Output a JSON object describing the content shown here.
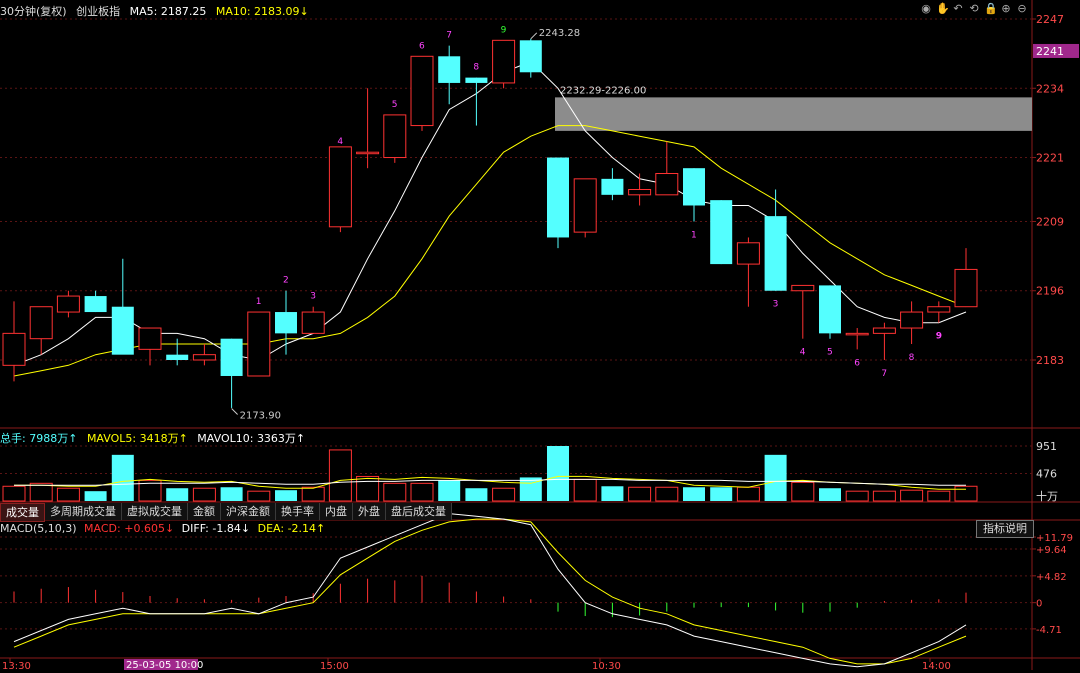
{
  "header": {
    "period": "30分钟(复权)",
    "symbol": "创业板指",
    "ma5_label": "MA5:",
    "ma5_value": "2187.25",
    "ma10_label": "MA10:",
    "ma10_value": "2183.09↓"
  },
  "toolbar": {
    "icons": [
      "eye-icon",
      "hand-icon",
      "undo-icon",
      "refresh-icon",
      "lock-icon",
      "zoom-in-icon",
      "zoom-out-icon"
    ],
    "glyphs": [
      "◉",
      "✋",
      "↶",
      "⟲",
      "🔒",
      "⊕",
      "⊖"
    ]
  },
  "price_axis": {
    "labels": [
      "2247",
      "2234",
      "2221",
      "2209",
      "2196",
      "2183"
    ],
    "current_price": "2241",
    "current_color": "#a0288c"
  },
  "annotations": {
    "high": "2243.28",
    "low": "2173.90",
    "gap": "2232.29-2226.00"
  },
  "td_labels": {
    "red": [
      "1",
      "2",
      "3",
      "4",
      "5",
      "6",
      "7",
      "8",
      "9"
    ],
    "green": [
      "1",
      "3",
      "4",
      "5",
      "6",
      "7",
      "8",
      "9"
    ]
  },
  "volume": {
    "total_label": "总手:",
    "total_value": "7988万↑",
    "mavol5_label": "MAVOL5:",
    "mavol5_value": "3418万↑",
    "mavol10_label": "MAVOL10:",
    "mavol10_value": "3363万↑",
    "axis": [
      "951",
      "476",
      "十万"
    ]
  },
  "tabs": [
    "成交量",
    "多周期成交量",
    "虚拟成交量",
    "金额",
    "沪深金额",
    "换手率",
    "内盘",
    "外盘",
    "盘后成交量"
  ],
  "macd": {
    "title": "MACD(5,10,3)",
    "macd_label": "MACD:",
    "macd_value": "+0.605↓",
    "diff_label": "DIFF:",
    "diff_value": "-1.84↓",
    "dea_label": "DEA:",
    "dea_value": "-2.14↑",
    "axis": [
      "+11.79",
      "+9.64",
      "+4.82",
      "0",
      "-4.71"
    ],
    "indicator_button": "指标说明"
  },
  "time_axis": {
    "labels": [
      "13:30",
      "15:00",
      "10:30",
      "14:00"
    ],
    "cursor_date": "25-03-05 10:00"
  },
  "colors": {
    "up": "#ff3232",
    "down": "#54ffff",
    "ma5": "#ffffff",
    "ma10": "#ffff00",
    "magenta": "#ff44ff",
    "td_green": "#33ff33"
  },
  "chart_data": {
    "type": "candlestick",
    "candles": [
      {
        "o": 2182,
        "h": 2194,
        "l": 2179,
        "c": 2188,
        "v": 1.5
      },
      {
        "o": 2187,
        "h": 2193,
        "l": 2184,
        "c": 2193,
        "v": 1.8
      },
      {
        "o": 2192,
        "h": 2196,
        "l": 2191,
        "c": 2195,
        "v": 1.3
      },
      {
        "o": 2195,
        "h": 2196,
        "l": 2192,
        "c": 2192,
        "v": 1.0
      },
      {
        "o": 2193,
        "h": 2202,
        "l": 2185,
        "c": 2184,
        "v": 4.7
      },
      {
        "o": 2185,
        "h": 2189,
        "l": 2182,
        "c": 2189,
        "v": 2.1
      },
      {
        "o": 2184,
        "h": 2187,
        "l": 2182,
        "c": 2183,
        "v": 1.3
      },
      {
        "o": 2183,
        "h": 2186,
        "l": 2182,
        "c": 2184,
        "v": 1.3
      },
      {
        "o": 2187,
        "h": 2187,
        "l": 2174,
        "c": 2180,
        "v": 1.4
      },
      {
        "o": 2180,
        "h": 2192,
        "l": 2180,
        "c": 2192,
        "v": 1.0
      },
      {
        "o": 2192,
        "h": 2196,
        "l": 2184,
        "c": 2188,
        "v": 1.1
      },
      {
        "o": 2188,
        "h": 2193,
        "l": 2188,
        "c": 2192,
        "v": 1.4
      },
      {
        "o": 2208,
        "h": 2222,
        "l": 2207,
        "c": 2223,
        "v": 5.2
      },
      {
        "o": 2222,
        "h": 2234,
        "l": 2219,
        "c": 2222,
        "v": 2.5
      },
      {
        "o": 2221,
        "h": 2229,
        "l": 2220,
        "c": 2229,
        "v": 1.8
      },
      {
        "o": 2227,
        "h": 2240,
        "l": 2226,
        "c": 2240,
        "v": 1.8
      },
      {
        "o": 2240,
        "h": 2242,
        "l": 2231,
        "c": 2235,
        "v": 2.1
      },
      {
        "o": 2236,
        "h": 2236,
        "l": 2227,
        "c": 2235,
        "v": 1.3
      },
      {
        "o": 2235,
        "h": 2243,
        "l": 2234,
        "c": 2243,
        "v": 1.3
      },
      {
        "o": 2243,
        "h": 2243.28,
        "l": 2236,
        "c": 2237,
        "v": 2.4
      },
      {
        "o": 2221,
        "h": 2221,
        "l": 2204,
        "c": 2206,
        "v": 5.6
      },
      {
        "o": 2207,
        "h": 2217,
        "l": 2206,
        "c": 2217,
        "v": 2.2
      },
      {
        "o": 2217,
        "h": 2219,
        "l": 2213,
        "c": 2214,
        "v": 1.5
      },
      {
        "o": 2214,
        "h": 2218,
        "l": 2212,
        "c": 2215,
        "v": 1.4
      },
      {
        "o": 2214,
        "h": 2224,
        "l": 2214,
        "c": 2218,
        "v": 1.4
      },
      {
        "o": 2219,
        "h": 2219,
        "l": 2209,
        "c": 2212,
        "v": 1.4
      },
      {
        "o": 2213,
        "h": 2213,
        "l": 2201,
        "c": 2201,
        "v": 1.4
      },
      {
        "o": 2201,
        "h": 2206,
        "l": 2193,
        "c": 2205,
        "v": 1.4
      },
      {
        "o": 2210,
        "h": 2215,
        "l": 2196,
        "c": 2196,
        "v": 4.7
      },
      {
        "o": 2196,
        "h": 2197,
        "l": 2187,
        "c": 2197,
        "v": 1.9
      },
      {
        "o": 2197,
        "h": 2197,
        "l": 2187,
        "c": 2188,
        "v": 1.3
      },
      {
        "o": 2188,
        "h": 2189,
        "l": 2185,
        "c": 2188,
        "v": 1.0
      },
      {
        "o": 2188,
        "h": 2190,
        "l": 2183,
        "c": 2189,
        "v": 1.0
      },
      {
        "o": 2189,
        "h": 2194,
        "l": 2186,
        "c": 2192,
        "v": 1.1
      },
      {
        "o": 2192,
        "h": 2194,
        "l": 2190,
        "c": 2193,
        "v": 1.0
      },
      {
        "o": 2193,
        "h": 2204,
        "l": 2193,
        "c": 2200,
        "v": 1.5
      }
    ],
    "ma5": [
      2182,
      2184,
      2187,
      2191,
      2191,
      2188,
      2188,
      2187,
      2184,
      2183,
      2186,
      2188,
      2192,
      2202,
      2211,
      2221,
      2230,
      2233,
      2237,
      2239,
      2234,
      2226,
      2221,
      2217,
      2216,
      2213,
      2212,
      2212,
      2209,
      2203,
      2198,
      2193,
      2191,
      2190,
      2190,
      2192
    ],
    "ma10": [
      2180,
      2181,
      2182,
      2184,
      2185,
      2186,
      2186,
      2186,
      2186,
      2186,
      2187,
      2187,
      2188,
      2191,
      2195,
      2202,
      2210,
      2216,
      2222,
      2225,
      2227,
      2227,
      2226,
      2225,
      2224,
      2223,
      2219,
      2216,
      2213,
      2209,
      2205,
      2202,
      2199,
      2197,
      2195,
      2193
    ],
    "td_up_index": [
      9,
      10,
      11,
      12,
      14,
      15,
      16,
      17,
      18
    ],
    "td_down_index": [
      25,
      28,
      29,
      30,
      31,
      32,
      33,
      34
    ],
    "vol_ma5": [
      1.6,
      1.6,
      1.5,
      1.5,
      2.0,
      2.2,
      2.0,
      1.9,
      2.0,
      1.5,
      1.3,
      1.3,
      2.1,
      2.3,
      2.2,
      2.4,
      2.3,
      2.1,
      1.9,
      1.8,
      2.5,
      2.5,
      2.3,
      2.2,
      2.1,
      1.6,
      1.5,
      1.4,
      2.0,
      2.1,
      1.9,
      1.8,
      1.7,
      1.4,
      1.2,
      1.2
    ],
    "vol_ma10": [
      1.6,
      1.6,
      1.6,
      1.6,
      1.7,
      1.8,
      1.8,
      1.8,
      1.9,
      1.8,
      1.7,
      1.7,
      1.9,
      2.0,
      2.0,
      2.1,
      2.1,
      2.1,
      2.1,
      2.1,
      2.2,
      2.2,
      2.2,
      2.1,
      2.1,
      2.1,
      2.1,
      2.0,
      2.0,
      2.0,
      1.9,
      1.8,
      1.7,
      1.7,
      1.6,
      1.6
    ],
    "macd_hist": [
      2.0,
      2.5,
      2.8,
      2.3,
      1.9,
      1.2,
      0.8,
      0.6,
      0.5,
      0.9,
      1.2,
      1.7,
      3.4,
      4.3,
      4.0,
      4.8,
      3.6,
      2.0,
      1.1,
      0.6,
      -1.6,
      -2.4,
      -2.6,
      -2.3,
      -1.6,
      -0.9,
      -0.8,
      -0.8,
      -1.4,
      -1.8,
      -1.6,
      -0.9,
      0.3,
      0.5,
      0.6,
      1.8
    ],
    "macd_diff": [
      -7,
      -5,
      -3,
      -2,
      -1,
      -2,
      -2,
      -2,
      -1,
      -2,
      0,
      1,
      8,
      10,
      12,
      14,
      16,
      15.5,
      15,
      14,
      6,
      0,
      -2,
      -3,
      -4,
      -6,
      -7,
      -8,
      -9,
      -10,
      -11,
      -11.5,
      -11,
      -9,
      -7,
      -4
    ],
    "macd_dea": [
      -8,
      -6,
      -4,
      -3,
      -2,
      -2,
      -2,
      -2,
      -2,
      -2,
      -1,
      0,
      5,
      8,
      11,
      13,
      14.5,
      15,
      15,
      14.5,
      9,
      4,
      1,
      -1,
      -2,
      -4,
      -5,
      -6,
      -7,
      -8,
      -10,
      -11,
      -11,
      -10,
      -8,
      -6
    ]
  }
}
